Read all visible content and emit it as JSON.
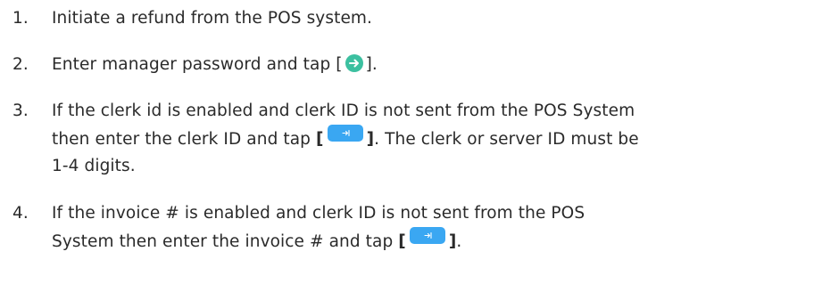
{
  "steps": [
    {
      "number": "1.",
      "lines": [
        "Initiate a refund from the POS system."
      ]
    },
    {
      "number": "2.",
      "before": "Enter manager password and tap [",
      "after": "].",
      "icon": "green-arrow-circle-icon"
    },
    {
      "number": "3.",
      "line1": "If the clerk id is enabled and clerk ID is not sent from the POS System",
      "line2_before": "then enter the clerk ID and tap",
      "bracket_open": "[",
      "bracket_close": "]",
      "line2_after": ".  The clerk or server ID must be",
      "line3": "1-4 digits.",
      "icon": "tab-key-icon"
    },
    {
      "number": "4.",
      "line1": "If the invoice # is enabled and clerk ID is not sent from the POS",
      "line2_before": "System then enter the invoice # and tap",
      "bracket_open": "[",
      "bracket_close": "]",
      "line2_after": ".",
      "icon": "tab-key-icon"
    }
  ],
  "colors": {
    "text": "#2a2a2a",
    "go_button": "#3cc0a0",
    "tab_button": "#3aa7f2"
  }
}
